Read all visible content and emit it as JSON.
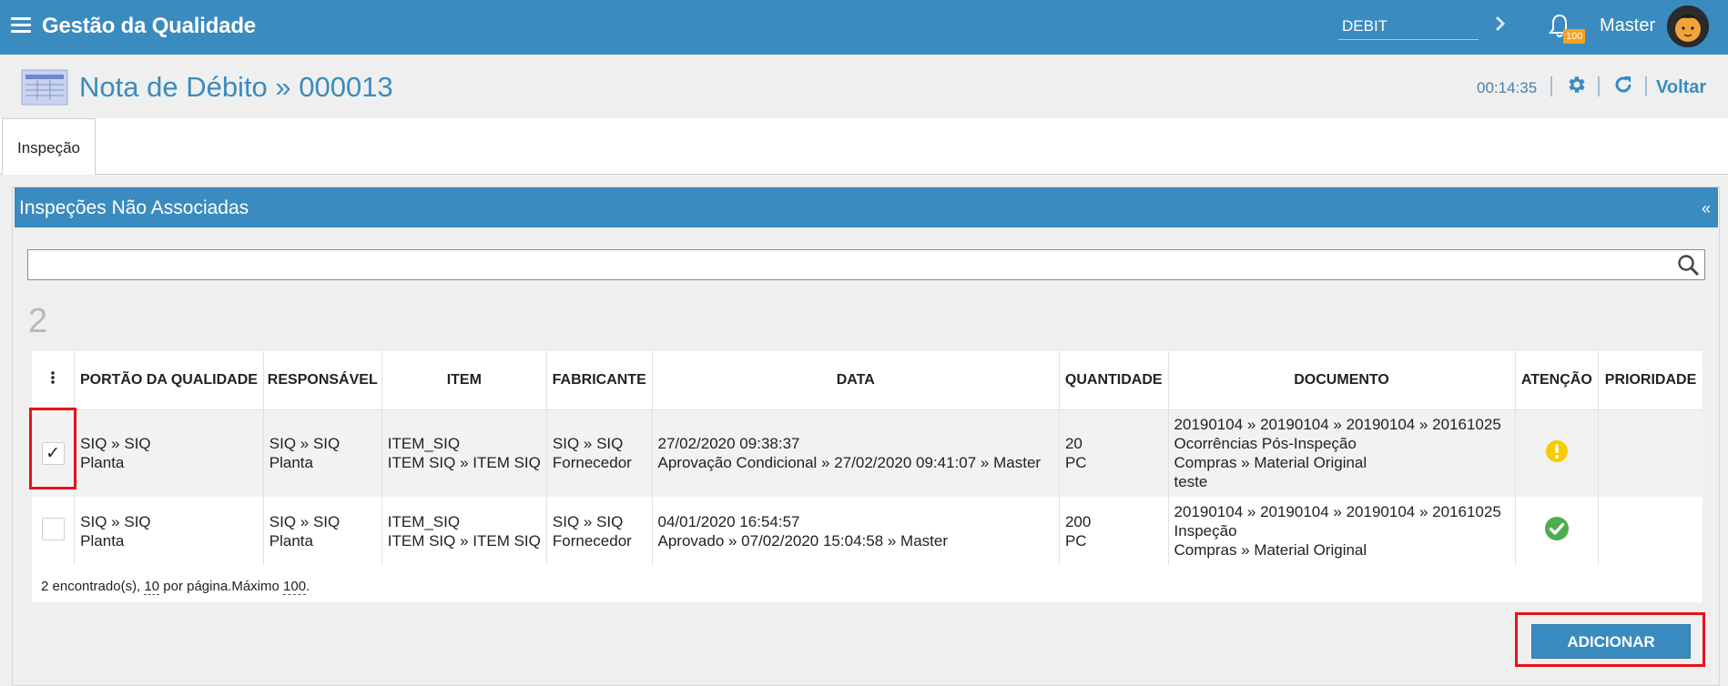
{
  "topbar": {
    "app_title": "Gestão da Qualidade",
    "select_value": "DEBIT",
    "notification_count": "100",
    "user_name": "Master"
  },
  "page": {
    "title": "Nota de Débito » 000013",
    "timer": "00:14:35",
    "back_label": "Voltar"
  },
  "tabs": [
    {
      "label": "Inspeção"
    }
  ],
  "panel": {
    "title": "Inspeções Não Associadas",
    "collapse_label": "«",
    "search_value": "",
    "result_count": "2"
  },
  "table": {
    "columns": [
      "PORTÃO DA QUALIDADE",
      "RESPONSÁVEL",
      "ITEM",
      "FABRICANTE",
      "DATA",
      "QUANTIDADE",
      "DOCUMENTO",
      "ATENÇÃO",
      "PRIORIDADE"
    ],
    "rows": [
      {
        "checked": true,
        "check_mark": "✓",
        "portao": [
          "SIQ » SIQ",
          "Planta"
        ],
        "responsavel": [
          "SIQ » SIQ",
          "Planta"
        ],
        "item": [
          "ITEM_SIQ",
          "ITEM SIQ » ITEM SIQ"
        ],
        "fabricante": [
          "SIQ » SIQ",
          "Fornecedor"
        ],
        "data": [
          "27/02/2020 09:38:37",
          "Aprovação Condicional » 27/02/2020 09:41:07 » Master"
        ],
        "quantidade": [
          "20",
          "PC"
        ],
        "documento": [
          "20190104 » 20190104 » 20190104 » 20161025",
          "Ocorrências Pós-Inspeção",
          "Compras » Material Original",
          "teste"
        ],
        "atencao_icon": "warning-icon",
        "atencao_color": "#f5cc00",
        "prioridade": ""
      },
      {
        "checked": false,
        "check_mark": "",
        "portao": [
          "SIQ » SIQ",
          "Planta"
        ],
        "responsavel": [
          "SIQ » SIQ",
          "Planta"
        ],
        "item": [
          "ITEM_SIQ",
          "ITEM SIQ » ITEM SIQ"
        ],
        "fabricante": [
          "SIQ » SIQ",
          "Fornecedor"
        ],
        "data": [
          "04/01/2020 16:54:57",
          "Aprovado » 07/02/2020 15:04:58 » Master"
        ],
        "quantidade": [
          "200",
          "PC"
        ],
        "documento": [
          "20190104 » 20190104 » 20190104 » 20161025",
          "Inspeção",
          "Compras » Material Original"
        ],
        "atencao_icon": "check-circle-icon",
        "atencao_color": "#4cae4c",
        "prioridade": ""
      }
    ],
    "footer": {
      "found_text": "2 encontrado(s),",
      "per_page_value": "10",
      "per_page_text": "por página.Máximo",
      "max_value": "100",
      "end": "."
    }
  },
  "actions": {
    "add_label": "ADICIONAR"
  },
  "colors": {
    "primary": "#3a8bbf",
    "highlight": "#e8121a",
    "badge": "#f7a21b"
  }
}
